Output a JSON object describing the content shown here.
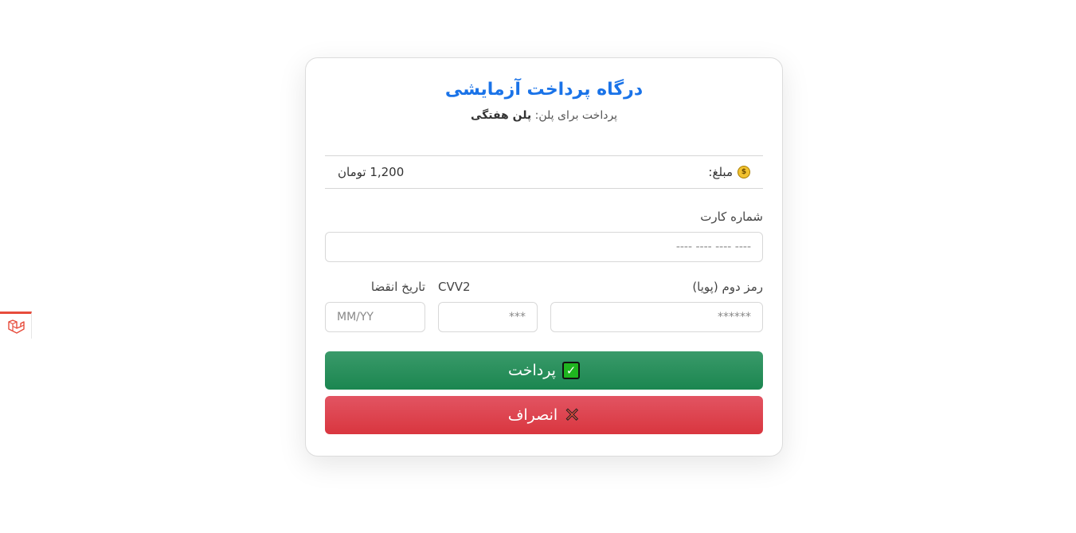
{
  "gateway": {
    "title": "درگاه پرداخت آزمایشی",
    "subtitle_prefix": "پرداخت برای پلن:",
    "plan_name": "پلن هفتگی"
  },
  "amount": {
    "icon": "money-bag-icon",
    "label": "مبلغ:",
    "value": "1,200 تومان"
  },
  "form": {
    "card_number": {
      "label": "شماره کارت",
      "placeholder": "---- ---- ---- ----",
      "value": ""
    },
    "pin2": {
      "label": "رمز دوم (پویا)",
      "placeholder": "******",
      "value": ""
    },
    "cvv2": {
      "label": "CVV2",
      "placeholder": "***",
      "value": ""
    },
    "expiry": {
      "label": "تاریخ انقضا",
      "placeholder": "MM/YY",
      "value": ""
    }
  },
  "buttons": {
    "pay": {
      "label": "پرداخت",
      "icon": "check-box-icon"
    },
    "cancel": {
      "label": "انصراف",
      "icon": "cross-mark-icon"
    }
  },
  "side_badge": {
    "icon": "laravel-logo-icon"
  },
  "colors": {
    "title": "#1a73e8",
    "pay": "#1b8650",
    "cancel": "#d9363f",
    "badge_accent": "#e74c3c"
  }
}
